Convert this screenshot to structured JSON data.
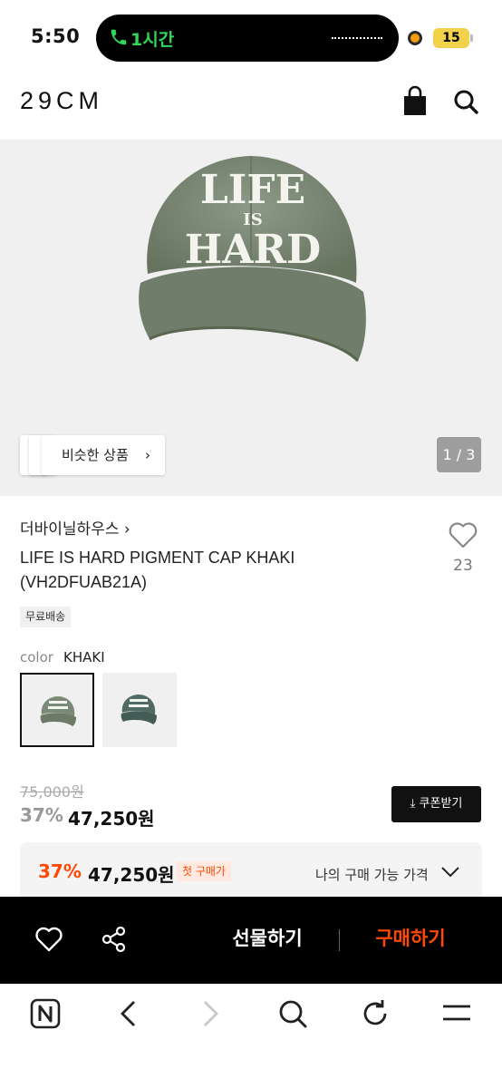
{
  "status_bar": {
    "time": "5:50",
    "call_duration": "1시간",
    "battery": "15"
  },
  "header": {
    "logo": "29CM",
    "icons": [
      "shopping-bag-icon",
      "search-icon"
    ]
  },
  "gallery": {
    "similar_label": "비슷한 상품",
    "similar_chevron": "›",
    "page_counter": "1 / 3",
    "cap_text_line1": "LIFE",
    "cap_text_line2": "IS",
    "cap_text_line3": "HARD"
  },
  "product": {
    "brand": "더바이닐하우스 ›",
    "name_line1": "LIFE IS HARD PIGMENT CAP KHAKI",
    "name_line2": "(VH2DFUAB21A)",
    "like_count": "23",
    "badge": "무료배송"
  },
  "options": {
    "color_label": "color",
    "color_value": "KHAKI",
    "swatches": [
      {
        "name": "KHAKI",
        "color": "#7b8a76",
        "selected": true
      },
      {
        "name": "GREEN",
        "color": "#4f6b63",
        "selected": false
      }
    ]
  },
  "price": {
    "original": "75,000원",
    "discount": "37%",
    "sale": "47,250원",
    "coupon_label": "⤓ 쿠폰받기"
  },
  "my_price": {
    "discount": "37%",
    "price": "47,250원",
    "tag": "첫 구매가",
    "label": "나의 구매 가능 가격"
  },
  "purchase_bar": {
    "gift_label": "선물하기",
    "buy_label": "구매하기"
  },
  "colors": {
    "accent": "#ff4800",
    "black": "#000000",
    "call_green": "#2fd75a"
  }
}
